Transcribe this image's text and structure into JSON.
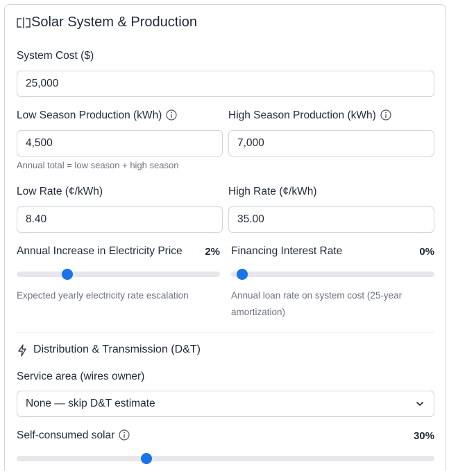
{
  "section": {
    "title": "Solar System & Production",
    "icon": "solar-panel-icon"
  },
  "system_cost": {
    "label": "System Cost ($)",
    "value": "25,000"
  },
  "low_season": {
    "label": "Low Season Production (kWh)",
    "value": "4,500",
    "hint": "Annual total = low season + high season"
  },
  "high_season": {
    "label": "High Season Production (kWh)",
    "value": "7,000"
  },
  "low_rate": {
    "label": "Low Rate (¢/kWh)",
    "value": "8.40"
  },
  "high_rate": {
    "label": "High Rate (¢/kWh)",
    "value": "35.00"
  },
  "annual_increase": {
    "label": "Annual Increase in Electricity Price",
    "display": "2%",
    "value_fraction": 0.22,
    "hint": "Expected yearly electricity rate escalation"
  },
  "financing": {
    "label": "Financing Interest Rate",
    "display": "0%",
    "value_fraction": 0.0,
    "hint": "Annual loan rate on system cost (25-year amortization)"
  },
  "dt": {
    "title": "Distribution & Transmission (D&T)",
    "icon": "lightning-icon",
    "service_label": "Service area (wires owner)",
    "service_selected": "None — skip D&T estimate"
  },
  "self_consumed": {
    "label": "Self-consumed solar",
    "display": "30%",
    "value_fraction": 0.3
  },
  "colors": {
    "accent": "#1a73e8",
    "border": "#d1d5db",
    "track": "#e5e7eb",
    "hint": "#6b7280"
  }
}
